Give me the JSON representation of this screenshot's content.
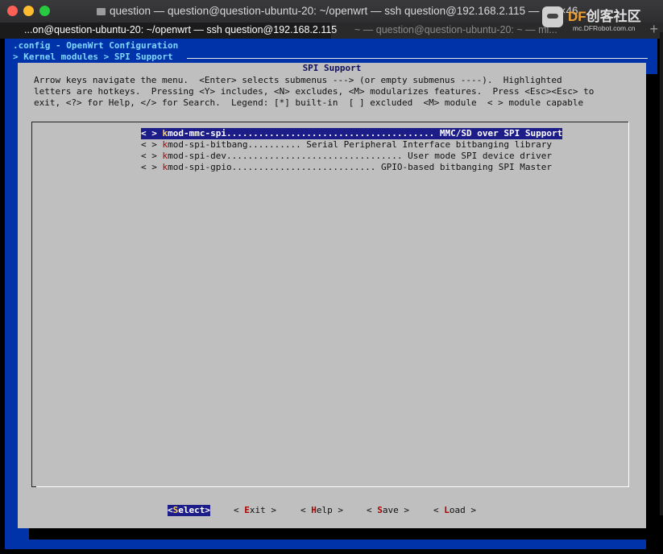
{
  "window": {
    "title": "question — question@question-ubuntu-20: ~/openwrt — ssh question@192.168.2.115 — 116×46"
  },
  "watermark": {
    "brand": "DF创客社区",
    "site": "mc.DFRobot.com.cn"
  },
  "tabs": [
    {
      "label": "...on@question-ubuntu-20: ~/openwrt — ssh question@192.168.2.115"
    },
    {
      "label": "~ — question@question-ubuntu-20: ~ — mi..."
    }
  ],
  "terminal": {
    "header_line1": ".config - OpenWrt Configuration",
    "header_line2": "> Kernel modules > SPI Support ",
    "dialog_title": "SPI Support",
    "help_text": "Arrow keys navigate the menu.  <Enter> selects submenus ---> (or empty submenus ----).  Highlighted\nletters are hotkeys.  Pressing <Y> includes, <N> excludes, <M> modularizes features.  Press <Esc><Esc> to\nexit, <?> for Help, </> for Search.  Legend: [*] built-in  [ ] excluded  <M> module  < > module capable",
    "menu": [
      {
        "prefix": "< > ",
        "hotkey": "k",
        "rest": "mod-mmc-spi....................................... MMC/SD over SPI Support"
      },
      {
        "prefix": "< > ",
        "hotkey": "k",
        "rest": "mod-spi-bitbang.......... Serial Peripheral Interface bitbanging library"
      },
      {
        "prefix": "< > ",
        "hotkey": "k",
        "rest": "mod-spi-dev................................. User mode SPI device driver"
      },
      {
        "prefix": "< > ",
        "hotkey": "k",
        "rest": "mod-spi-gpio........................... GPIO-based bitbanging SPI Master"
      }
    ],
    "buttons": [
      {
        "open": "<",
        "hotkey": "S",
        "rest": "elect",
        "close": ">"
      },
      {
        "open": "< ",
        "hotkey": "E",
        "rest": "xit",
        "close": " >"
      },
      {
        "open": "< ",
        "hotkey": "H",
        "rest": "elp",
        "close": " >"
      },
      {
        "open": "< ",
        "hotkey": "S",
        "rest": "ave",
        "close": " >"
      },
      {
        "open": "< ",
        "hotkey": "L",
        "rest": "oad",
        "close": " >"
      }
    ]
  },
  "colors": {
    "terminal_bg": "#0033aa",
    "dialog_bg": "#bfbfbf",
    "highlight_bg": "#1d1d8a",
    "hotkey": "#b00000"
  }
}
